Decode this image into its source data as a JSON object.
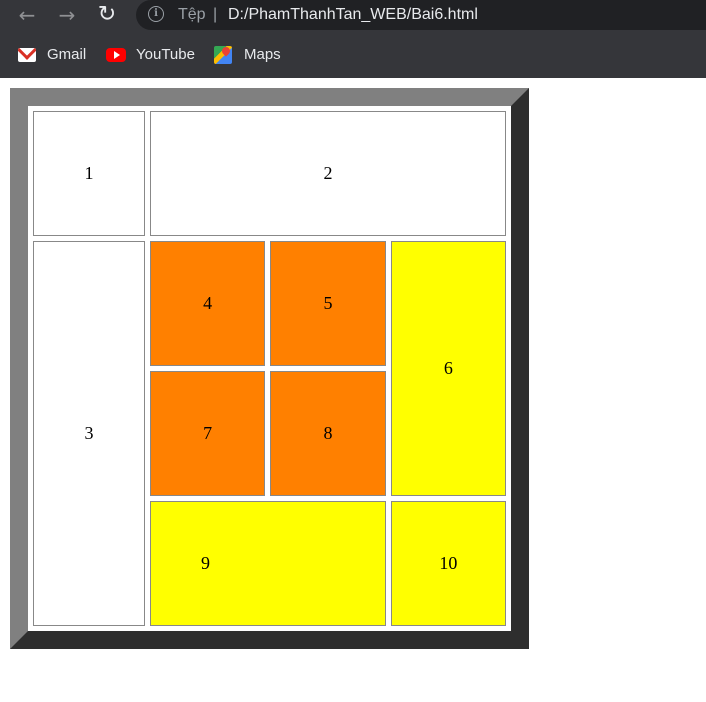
{
  "browser": {
    "nav": {
      "back_icon": "arrow-left-icon",
      "forward_icon": "arrow-right-icon",
      "reload_icon": "reload-icon"
    },
    "address_bar": {
      "info_icon": "info-icon",
      "scheme_label": "Tệp",
      "separator": "|",
      "url": "D:/PhamThanhTan_WEB/Bai6.html"
    },
    "bookmarks": [
      {
        "label": "Gmail",
        "icon": "gmail-icon"
      },
      {
        "label": "YouTube",
        "icon": "youtube-icon"
      },
      {
        "label": "Maps",
        "icon": "maps-icon"
      }
    ]
  },
  "page": {
    "colors": {
      "white": "#ffffff",
      "orange": "#ff8000",
      "yellow": "#ffff00",
      "border_light": "#808080",
      "border_dark": "#2e2e2e"
    },
    "cells": {
      "c1": "1",
      "c2": "2",
      "c3": "3",
      "c4": "4",
      "c5": "5",
      "c6": "6",
      "c7": "7",
      "c8": "8",
      "c9": "9",
      "c10": "10"
    }
  }
}
